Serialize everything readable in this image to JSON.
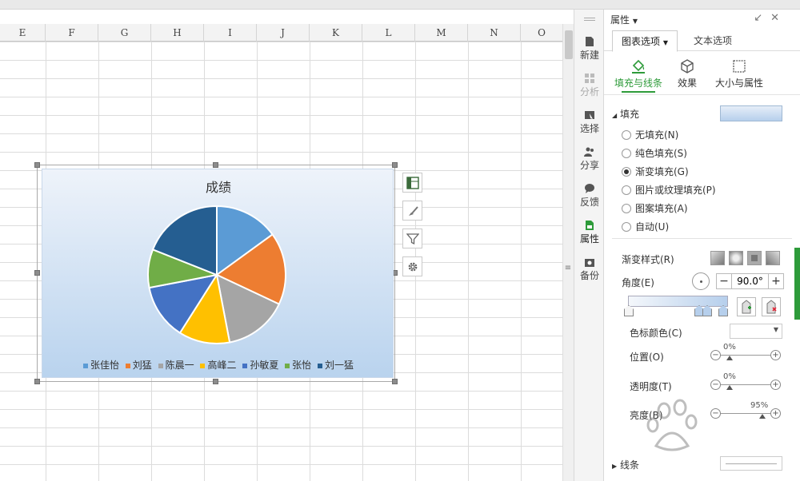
{
  "sheet": {
    "columns": [
      "E",
      "F",
      "G",
      "H",
      "I",
      "J",
      "K",
      "L",
      "M",
      "N",
      "O"
    ]
  },
  "chart": {
    "title": "成绩",
    "legend": [
      "张佳怡",
      "刘猛",
      "陈晨一",
      "高峰二",
      "孙敏夏",
      "张怡",
      "刘一猛"
    ]
  },
  "chart_data": {
    "type": "pie",
    "title": "成绩",
    "categories": [
      "张佳怡",
      "刘猛",
      "陈晨一",
      "高峰二",
      "孙敏夏",
      "张怡",
      "刘一猛"
    ],
    "values": [
      15,
      17,
      15,
      12,
      13,
      9,
      19
    ],
    "colors": [
      "#5b9bd5",
      "#ed7d31",
      "#a5a5a5",
      "#ffc000",
      "#4472c4",
      "#70ad47",
      "#255e91"
    ],
    "legend_position": "bottom"
  },
  "sidebar": {
    "items": [
      {
        "label": "新建",
        "state": "normal"
      },
      {
        "label": "分析",
        "state": "disabled"
      },
      {
        "label": "选择",
        "state": "normal"
      },
      {
        "label": "分享",
        "state": "normal"
      },
      {
        "label": "反馈",
        "state": "normal"
      },
      {
        "label": "属性",
        "state": "active"
      },
      {
        "label": "备份",
        "state": "normal"
      }
    ]
  },
  "panel": {
    "title": "属性",
    "tabs": [
      "图表选项",
      "文本选项"
    ],
    "subtabs": [
      "填充与线条",
      "效果",
      "大小与属性"
    ],
    "fill_section": "填充",
    "fill_options": [
      "无填充(N)",
      "纯色填充(S)",
      "渐变填充(G)",
      "图片或纹理填充(P)",
      "图案填充(A)",
      "自动(U)"
    ],
    "fill_selected": 2,
    "gradient_style_label": "渐变样式(R)",
    "angle_label": "角度(E)",
    "angle_value": "90.0°",
    "stop_color_label": "色标颜色(C)",
    "position_label": "位置(O)",
    "position_value": "0%",
    "transparency_label": "透明度(T)",
    "transparency_value": "0%",
    "brightness_label": "亮度(B)",
    "brightness_value": "95%",
    "line_section": "线条",
    "accent": "#2e9b3a"
  }
}
